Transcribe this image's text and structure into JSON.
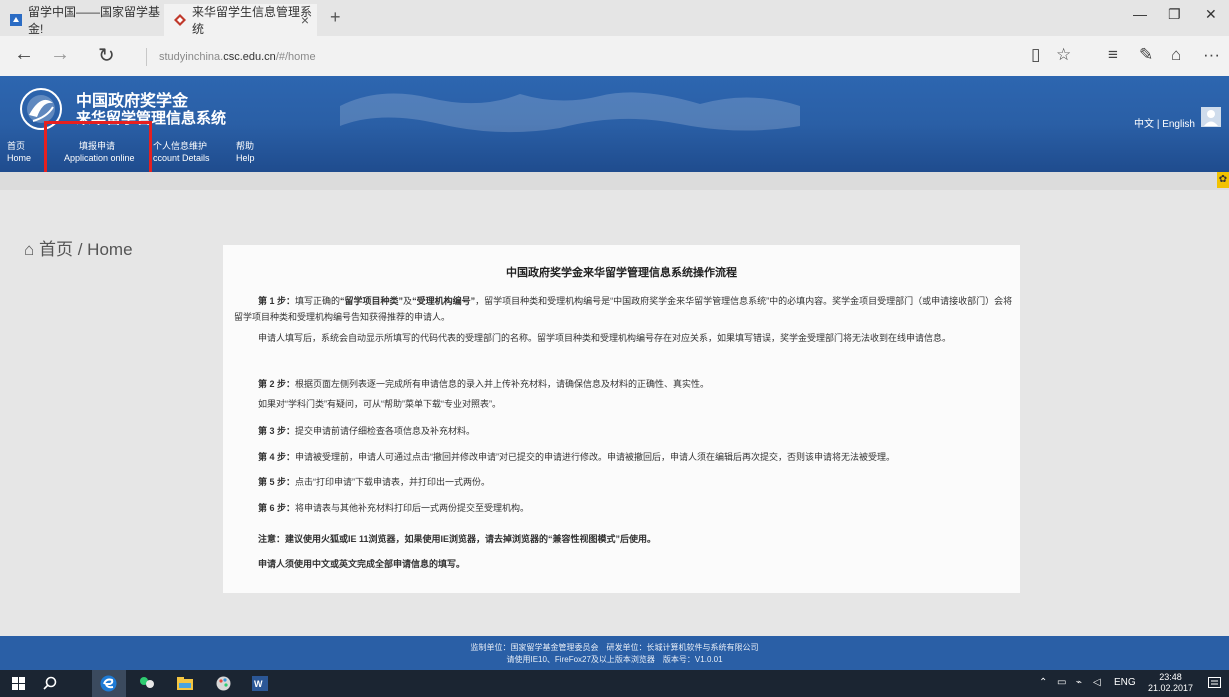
{
  "browser": {
    "tabs": [
      {
        "label": "留学中国——国家留学基金!"
      },
      {
        "label": "来华留学生信息管理系统"
      }
    ],
    "tab_close": "×",
    "new_tab": "+",
    "window": {
      "minimize": "—",
      "restore": "❐",
      "close": "✕"
    },
    "nav": {
      "back": "←",
      "forward": "→",
      "refresh": "↻"
    },
    "url_prefix": "studyinchina.",
    "url_domain": "csc.edu.cn",
    "url_path": "/#/home",
    "toolbar": {
      "reading": "▯",
      "favorite": "☆",
      "hub": "≡",
      "note": "✎",
      "share": "⌂",
      "more": "···"
    }
  },
  "site": {
    "title_line1": "中国政府奖学金",
    "title_line2": "来华留学管理信息系统",
    "lang_switch": "中文 | English",
    "nav": [
      {
        "zh": "首页",
        "en": "Home"
      },
      {
        "zh": "填报申请",
        "en": "Application online"
      },
      {
        "zh": "个人信息维护",
        "en": "ccount Details"
      },
      {
        "zh": "帮助",
        "en": "Help"
      }
    ],
    "settings_glyph": "✿"
  },
  "breadcrumb": {
    "icon": "⌂",
    "text": "首页 / Home"
  },
  "content": {
    "title": "中国政府奖学金来华留学管理信息系统操作流程",
    "step1_lead": "第 1 步：",
    "step1_pre": "填写正确的",
    "step1_b1": "“留学项目种类”",
    "step1_mid": "及",
    "step1_b2": "“受理机构编号”",
    "step1_rest": "，留学项目种类和受理机构编号是“中国政府奖学金来华留学管理信息系统”中的必填内容。奖学金项目受理部门（或申请接收部门）会将留学项目种类和受理机构编号告知获得推荐的申请人。",
    "step1_extra": "申请人填写后，系统会自动显示所填写的代码代表的受理部门的名称。留学项目种类和受理机构编号存在对应关系，如果填写错误，奖学金受理部门将无法收到在线申请信息。",
    "step2_lead": "第 2 步：",
    "step2": "根据页面左侧列表逐一完成所有申请信息的录入并上传补充材料，请确保信息及材料的正确性、真实性。",
    "step2_extra": "如果对“学科门类”有疑问，可从“帮助”菜单下载“专业对照表”。",
    "step3_lead": "第 3 步：",
    "step3": "提交申请前请仔细检查各项信息及补充材料。",
    "step4_lead": "第 4 步：",
    "step4": "申请被受理前，申请人可通过点击“撤回并修改申请”对已提交的申请进行修改。申请被撤回后，申请人须在编辑后再次提交，否则该申请将无法被受理。",
    "step5_lead": "第 5 步：",
    "step5": "点击“打印申请”下载申请表，并打印出一式两份。",
    "step6_lead": "第 6 步：",
    "step6": "将申请表与其他补充材料打印后一式两份提交至受理机构。",
    "note": "注意：建议使用火狐或IE 11浏览器，如果使用IE浏览器，请去掉浏览器的“兼容性视图模式”后使用。",
    "lang_note": "申请人须使用中文或英文完成全部申请信息的填写。"
  },
  "footer": {
    "line1": "监制单位：国家留学基金管理委员会　研发单位：长城计算机软件与系统有限公司",
    "line2": "请使用IE10、FireFox27及以上版本浏览器　版本号：V1.0.01"
  },
  "taskbar": {
    "lang": "ENG",
    "time": "23:48",
    "date": "21.02.2017"
  },
  "colors": {
    "header_blue": "#2a5fa6",
    "highlight_red": "#e62020",
    "taskbar": "#1b2532"
  }
}
